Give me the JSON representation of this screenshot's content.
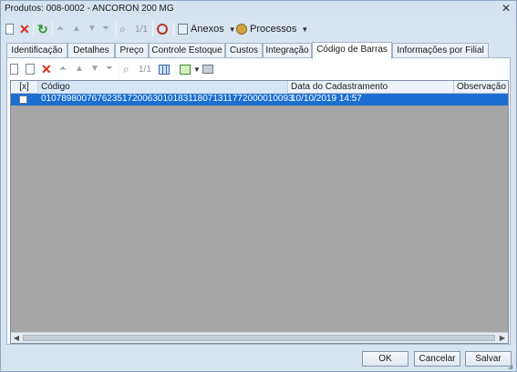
{
  "window": {
    "title": "Produtos: 008-0002 - ANCORON 200 MG"
  },
  "toolbar": {
    "pager": "1/1",
    "anexos_label": "Anexos",
    "processos_label": "Processos"
  },
  "tabs": [
    {
      "label": "Identificação"
    },
    {
      "label": "Detalhes"
    },
    {
      "label": "Preço"
    },
    {
      "label": "Controle Estoque"
    },
    {
      "label": "Custos"
    },
    {
      "label": "Integração"
    },
    {
      "label": "Código de Barras",
      "active": true
    },
    {
      "label": "Informações por Filial"
    }
  ],
  "subtoolbar": {
    "pager": "1/1"
  },
  "grid": {
    "columns": [
      "[x]",
      "Código",
      "Data do Cadastramento",
      "Observação"
    ],
    "rows": [
      {
        "checked": false,
        "codigo": "01078980076762351720063010183118071311772000010093",
        "data": "10/10/2019 14:57",
        "observacao": ""
      }
    ]
  },
  "buttons": {
    "ok": "OK",
    "cancelar": "Cancelar",
    "salvar": "Salvar"
  },
  "icons": {
    "close": "close-icon",
    "new": "new-document-icon",
    "delete": "delete-icon",
    "refresh": "refresh-icon",
    "search": "search-icon",
    "attachment": "attachment-icon",
    "processes": "gear-icon"
  },
  "colors": {
    "selection": "#1c6fd1",
    "grid_bg": "#a6a6a6",
    "window_bg": "#d9e4f1"
  }
}
